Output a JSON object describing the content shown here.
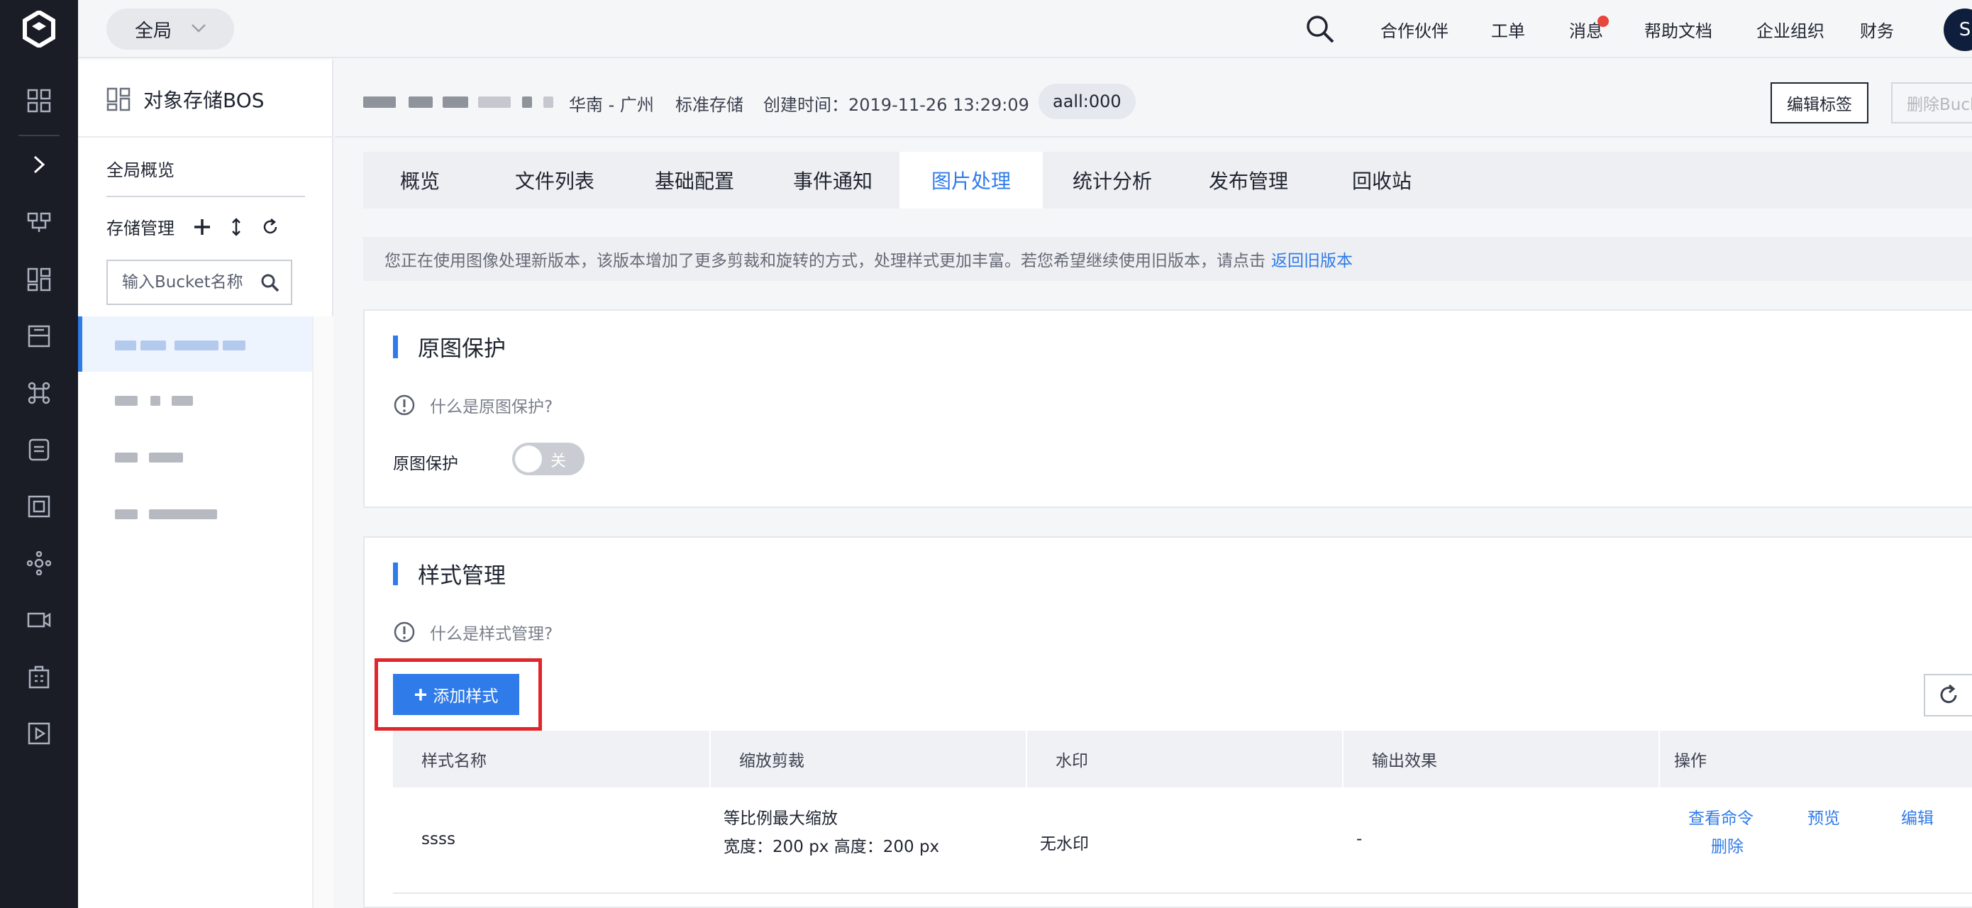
{
  "topbar": {
    "scope": "全局",
    "nav": [
      "合作伙伴",
      "工单",
      "消息",
      "帮助文档",
      "企业组织",
      "财务"
    ],
    "avatar": "S"
  },
  "sidebar": {
    "product_title": "对象存储BOS",
    "overview": "全局概览",
    "storage_mgmt": "存储管理",
    "search_placeholder": "输入Bucket名称"
  },
  "header": {
    "region": "华南 - 广州",
    "storage_class": "标准存储",
    "created": "创建时间：2019-11-26 13:29:09",
    "tag": "aall:000",
    "edit_tags": "编辑标签",
    "delete_bucket": "删除Bucket"
  },
  "tabs": [
    "概览",
    "文件列表",
    "基础配置",
    "事件通知",
    "图片处理",
    "统计分析",
    "发布管理",
    "回收站"
  ],
  "active_tab": "图片处理",
  "notice": {
    "text": "您正在使用图像处理新版本，该版本增加了更多剪裁和旋转的方式，处理样式更加丰富。若您希望继续使用旧版本，请点击",
    "link": "返回旧版本"
  },
  "protect": {
    "title": "原图保护",
    "help": "什么是原图保护?",
    "label": "原图保护",
    "toggle_text": "关",
    "toggle_on": false
  },
  "styles": {
    "title": "样式管理",
    "help": "什么是样式管理?",
    "add_button": "添加样式",
    "columns": [
      "样式名称",
      "缩放剪裁",
      "水印",
      "输出效果",
      "操作"
    ],
    "rows": [
      {
        "name": "ssss",
        "resize_line1": "等比例最大缩放",
        "resize_line2": "宽度：200 px 高度：200 px",
        "watermark": "无水印",
        "output": "-",
        "actions": [
          "查看命令",
          "预览",
          "编辑",
          "删除"
        ]
      }
    ]
  },
  "colors": {
    "accent": "#2f7bea",
    "rail": "#1a1d26",
    "highlight": "#e0262a",
    "badge": "#e8453c"
  }
}
